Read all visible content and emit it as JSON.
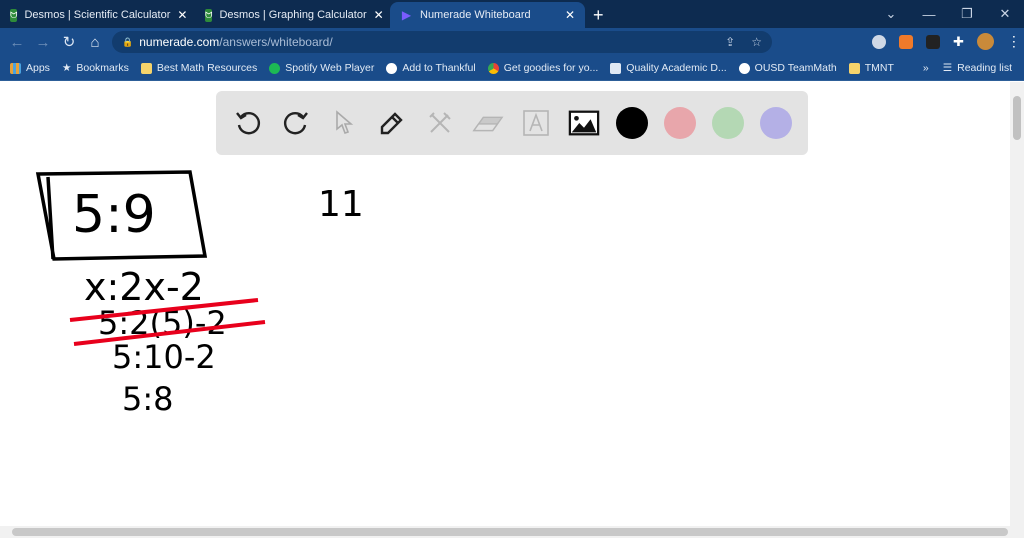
{
  "tabs": [
    {
      "title": "Desmos | Scientific Calculator",
      "active": false
    },
    {
      "title": "Desmos | Graphing Calculator",
      "active": false
    },
    {
      "title": "Numerade Whiteboard",
      "active": true
    }
  ],
  "address": {
    "domain": "numerade.com",
    "path": "/answers/whiteboard/"
  },
  "bookmarks": [
    {
      "label": "Apps",
      "color": "#e6a23c"
    },
    {
      "label": "Bookmarks",
      "color": "#ffffff"
    },
    {
      "label": "Best Math Resources",
      "color": "#f5d36b"
    },
    {
      "label": "Spotify Web Player",
      "color": "#1db954"
    },
    {
      "label": "Add to Thankful",
      "color": "#ffffff"
    },
    {
      "label": "Get goodies for yo...",
      "color": "#e94235"
    },
    {
      "label": "Quality Academic D...",
      "color": "#ffffff"
    },
    {
      "label": "OUSD TeamMath",
      "color": "#ffffff"
    },
    {
      "label": "TMNT",
      "color": "#f5d36b"
    }
  ],
  "reading_list": "Reading list",
  "whiteboard": {
    "colors": [
      "#000000",
      "#e8a6ab",
      "#b4d8b4",
      "#b4b0e6"
    ],
    "ink": {
      "boxed": "5:9",
      "line1": "x:2x-2",
      "crossed": "5:2(5)-2",
      "line3": "5:10-2",
      "line4": "5:8",
      "side": "11"
    }
  }
}
